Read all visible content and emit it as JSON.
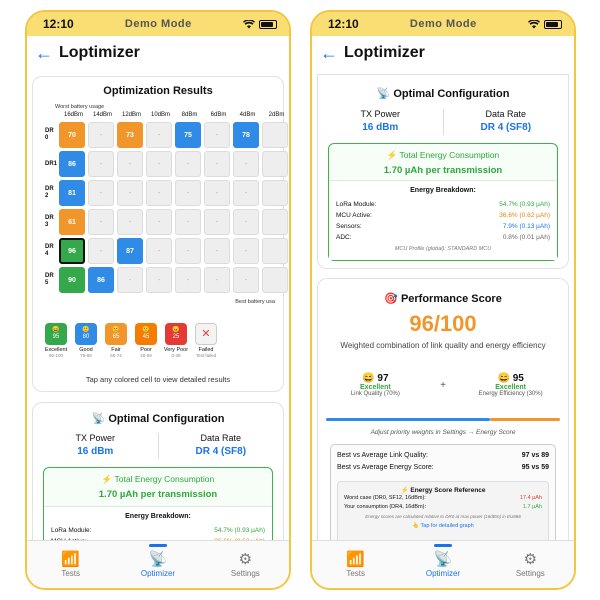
{
  "status": {
    "time": "12:10",
    "mode": "Demo Mode",
    "icons": [
      "wifi-icon",
      "battery-icon"
    ]
  },
  "nav": {
    "title": "Loptimizer"
  },
  "tabs": [
    {
      "label": "Tests",
      "icon": "antenna-icon"
    },
    {
      "label": "Optimizer",
      "icon": "broadcast-icon",
      "active": true
    },
    {
      "label": "Settings",
      "icon": "gear-icon"
    }
  ],
  "results": {
    "title": "Optimization Results",
    "worst_label": "Worst battery usage",
    "best_label": "Best battery usa",
    "columns": [
      "16dBm",
      "14dBm",
      "12dBm",
      "10dBm",
      "8dBm",
      "6dBm",
      "4dBm",
      "2dBm"
    ],
    "rows": [
      {
        "label": "DR\n0",
        "cells": [
          "70",
          "-",
          "73",
          "-",
          "75",
          "-",
          "78",
          ""
        ]
      },
      {
        "label": "DR1",
        "cells": [
          "86",
          "-",
          "-",
          "-",
          "-",
          "-",
          "-",
          ""
        ]
      },
      {
        "label": "DR\n2",
        "cells": [
          "81",
          "-",
          "-",
          "-",
          "-",
          "-",
          "-",
          ""
        ]
      },
      {
        "label": "DR\n3",
        "cells": [
          "61",
          "-",
          "-",
          "-",
          "-",
          "-",
          "-",
          ""
        ]
      },
      {
        "label": "DR\n4",
        "cells": [
          "96",
          "-",
          "87",
          "-",
          "-",
          "-",
          "-",
          ""
        ]
      },
      {
        "label": "DR\n5",
        "cells": [
          "90",
          "86",
          "-",
          "-",
          "-",
          "-",
          "-",
          ""
        ]
      }
    ],
    "legend": [
      {
        "name": "Excellent",
        "range": "90-100",
        "color": "#35a84b",
        "icon": "grin-face-icon",
        "value": "95"
      },
      {
        "name": "Good",
        "range": "75-89",
        "color": "#2f8be6",
        "icon": "smile-face-icon",
        "value": "80"
      },
      {
        "name": "Fair",
        "range": "60-74",
        "color": "#f0962b",
        "icon": "neutral-face-icon",
        "value": "65"
      },
      {
        "name": "Poor",
        "range": "40-59",
        "color": "#f57c00",
        "icon": "sad-face-icon",
        "value": "45"
      },
      {
        "name": "Very Poor",
        "range": "0-39",
        "color": "#e53935",
        "icon": "angry-face-icon",
        "value": "25"
      },
      {
        "name": "Failed",
        "range": "Test failed",
        "color": "#f3f3f3",
        "icon": "cross-icon",
        "value": ""
      }
    ],
    "tap_hint": "Tap any colored cell to view detailed results"
  },
  "config": {
    "title": "Optimal Configuration",
    "icon": "satellite-dish-icon",
    "tx_label": "TX Power",
    "tx_value": "16 dBm",
    "dr_label": "Data Rate",
    "dr_value": "DR 4 (SF8)",
    "energy_title": "⚡ Total Energy Consumption",
    "energy_value": "1.70 µAh per transmission",
    "breakdown_title": "Energy Breakdown:",
    "breakdown": [
      {
        "label": "LoRa Module:",
        "value": "54.7% (0.93 µAh)",
        "color": "green"
      },
      {
        "label": "MCU Active:",
        "value": "36.6% (0.62 µAh)",
        "color": "orange"
      },
      {
        "label": "Sensors:",
        "value": "7.9% (0.13 µAh)",
        "color": "blue"
      },
      {
        "label": "ADC:",
        "value": "0.8% (0.01 µAh)",
        "color": "gray"
      }
    ],
    "mcu_profile": "MCU Profile (global): STANDARD MCU"
  },
  "performance": {
    "title": "Performance Score",
    "icon": "target-icon",
    "score": "96/100",
    "subtitle": "Weighted combination of link quality and energy efficiency",
    "link_value": "97",
    "link_rating": "Excellent",
    "link_label": "Link Quality (70%)",
    "energy_value": "95",
    "energy_rating": "Excellent",
    "energy_label": "Energy Efficiency (30%)",
    "plus": "+",
    "weight_link": 0.7,
    "adjust_hint": "Adjust priority weights in Settings → Energy Score",
    "best_vs_link_label": "Best vs Average Link Quality:",
    "best_vs_link_value": "97 vs 89",
    "best_vs_energy_label": "Best vs Average Energy Score:",
    "best_vs_energy_value": "95 vs 59",
    "ref_title": "⚡ Energy Score Reference",
    "worst_case_label": "Worst case (DR0, SF12, 16dBm):",
    "worst_case_value": "17.4 µAh",
    "yours_label": "Your consumption (DR4, 16dBm):",
    "yours_value": "1.7 µAh",
    "ref_note": "Energy scores are calculated relative to DR0 at max power (16dBm) in EU868",
    "tap_graph": "👆 Tap for detailed graph"
  }
}
